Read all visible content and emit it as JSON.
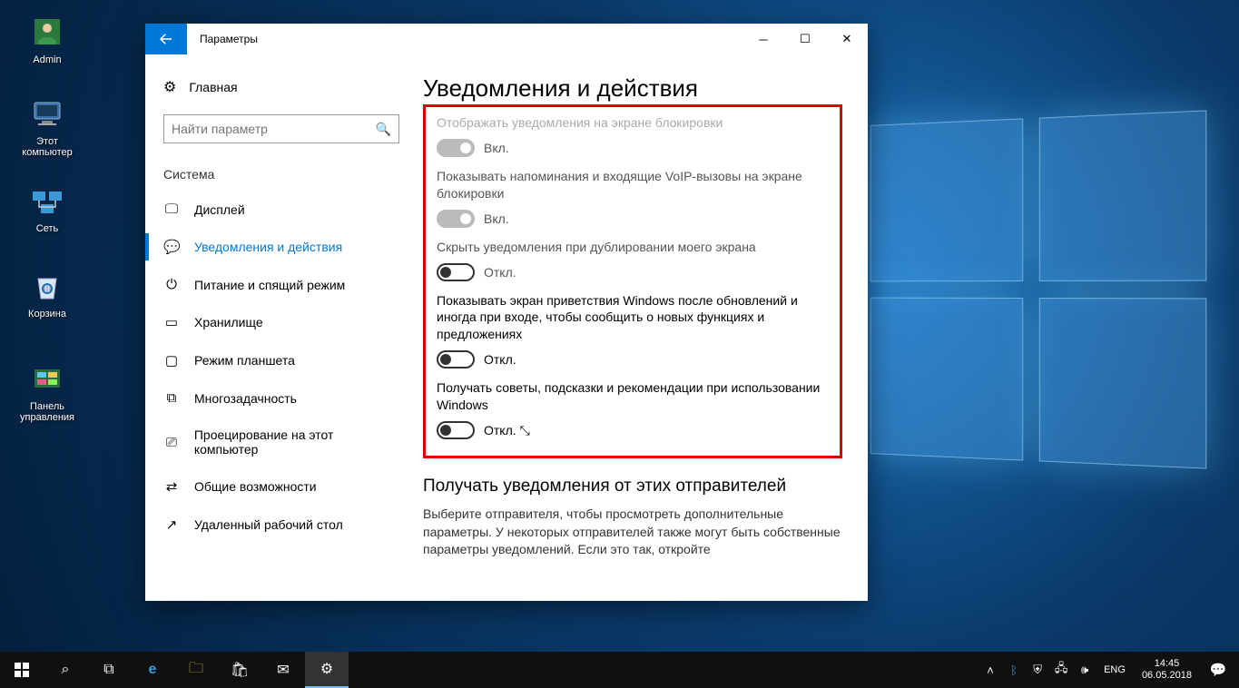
{
  "desktop": {
    "icons": [
      {
        "label": "Admin",
        "glyph": "user"
      },
      {
        "label": "Этот компьютер",
        "glyph": "pc"
      },
      {
        "label": "Сеть",
        "glyph": "net"
      },
      {
        "label": "Корзина",
        "glyph": "bin"
      },
      {
        "label": "Панель управления",
        "glyph": "cp"
      }
    ]
  },
  "window": {
    "title": "Параметры",
    "home": "Главная",
    "search_placeholder": "Найти параметр",
    "section": "Система",
    "nav": [
      {
        "icon": "display",
        "label": "Дисплей"
      },
      {
        "icon": "chat",
        "label": "Уведомления и действия"
      },
      {
        "icon": "power",
        "label": "Питание и спящий режим"
      },
      {
        "icon": "storage",
        "label": "Хранилище"
      },
      {
        "icon": "tablet",
        "label": "Режим планшета"
      },
      {
        "icon": "multi",
        "label": "Многозадачность"
      },
      {
        "icon": "project",
        "label": "Проецирование на этот компьютер"
      },
      {
        "icon": "share",
        "label": "Общие возможности"
      },
      {
        "icon": "remote",
        "label": "Удаленный рабочий стол"
      }
    ],
    "active_nav": 1
  },
  "content": {
    "title": "Уведомления и действия",
    "cut_label": "Отображать уведомления на экране блокировки",
    "settings": [
      {
        "label": "",
        "state": "Вкл.",
        "disabled": true,
        "on": true
      },
      {
        "label": "Показывать напоминания и входящие VoIP-вызовы на экране блокировки",
        "state": "Вкл.",
        "disabled": true,
        "on": true
      },
      {
        "label": "Скрыть уведомления при дублировании моего экрана",
        "state": "Откл.",
        "disabled": false,
        "on": false
      },
      {
        "label": "Показывать экран приветствия Windows после обновлений и иногда при входе, чтобы сообщить о новых функциях и предложениях",
        "state": "Откл.",
        "disabled": false,
        "on": false,
        "dark": true
      },
      {
        "label": "Получать советы, подсказки и рекомендации при использовании Windows",
        "state": "Откл.",
        "disabled": false,
        "on": false,
        "dark": true,
        "cursor": true
      }
    ],
    "subhead": "Получать уведомления от этих отправителей",
    "para": "Выберите отправителя, чтобы просмотреть дополнительные параметры. У некоторых отправителей также могут быть собственные параметры уведомлений. Если это так, откройте"
  },
  "taskbar": {
    "lang": "ENG",
    "time": "14:45",
    "date": "06.05.2018"
  }
}
